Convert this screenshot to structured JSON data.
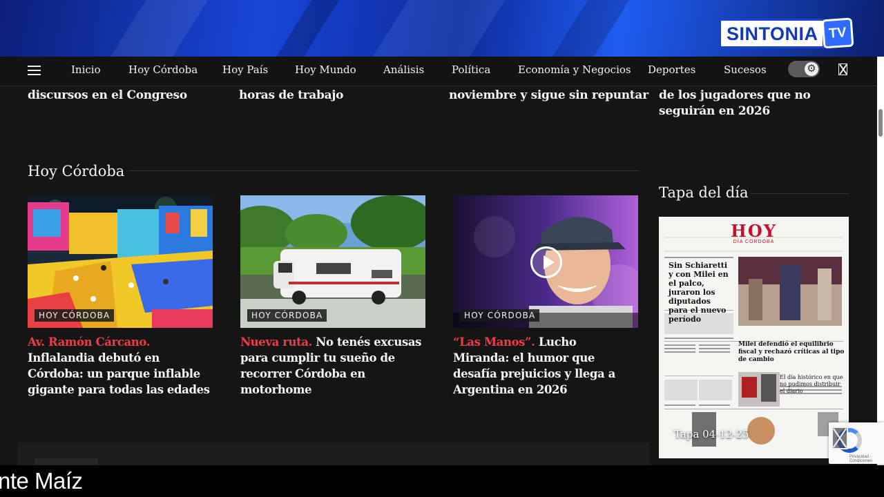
{
  "banner": {
    "logo_text": "SINTONIA",
    "logo_tv": "TV"
  },
  "nav": {
    "items": [
      "Inicio",
      "Hoy Córdoba",
      "Hoy País",
      "Hoy Mundo",
      "Análisis",
      "Política",
      "Economía y Negocios",
      "Deportes",
      "Sucesos"
    ]
  },
  "top_headlines": [
    "discursos en el Congreso",
    "horas de trabajo",
    "noviembre y sigue sin repuntar",
    "de los jugadores que no seguirán en 2026"
  ],
  "section": {
    "title": "Hoy Córdoba",
    "cards": [
      {
        "badge": "HOY CÓRDOBA",
        "kicker": "Av. Ramón Cárcano.",
        "title": " Inflalandia debutó en Córdoba: un parque inflable gigante para todas las edades"
      },
      {
        "badge": "HOY CÓRDOBA",
        "kicker": "Nueva ruta.",
        "title": " No tenés excusas para cumplir tu sueño de recorrer Córdoba en motorhome"
      },
      {
        "badge": "HOY CÓRDOBA",
        "kicker": "“Las Manos”.",
        "title": " Lucho Miranda: el humor que desafía prejuicios y llega a Argentina en 2026"
      }
    ]
  },
  "tapa": {
    "title": "Tapa del día",
    "label": "Tapa 04-12-25",
    "paper_name": "HOY",
    "paper_sub": "DÍA CÓRDOBA",
    "main_headline": "Sin Schiaretti y con Milei en el palco, juraron los diputados para el nuevo período",
    "second_headline": "Milei defendió el equilibrio fiscal y rechazó críticas al tipo de cambio",
    "third_headline": "El día histórico en que no pudimos distribuir el diario"
  },
  "recaptcha": {
    "text": "Privacidad - Condiciones"
  },
  "ticker": {
    "text": "nte Maíz"
  },
  "colors": {
    "kicker": "#ef3b47",
    "background": "#151515",
    "banner": "#1846d8"
  }
}
